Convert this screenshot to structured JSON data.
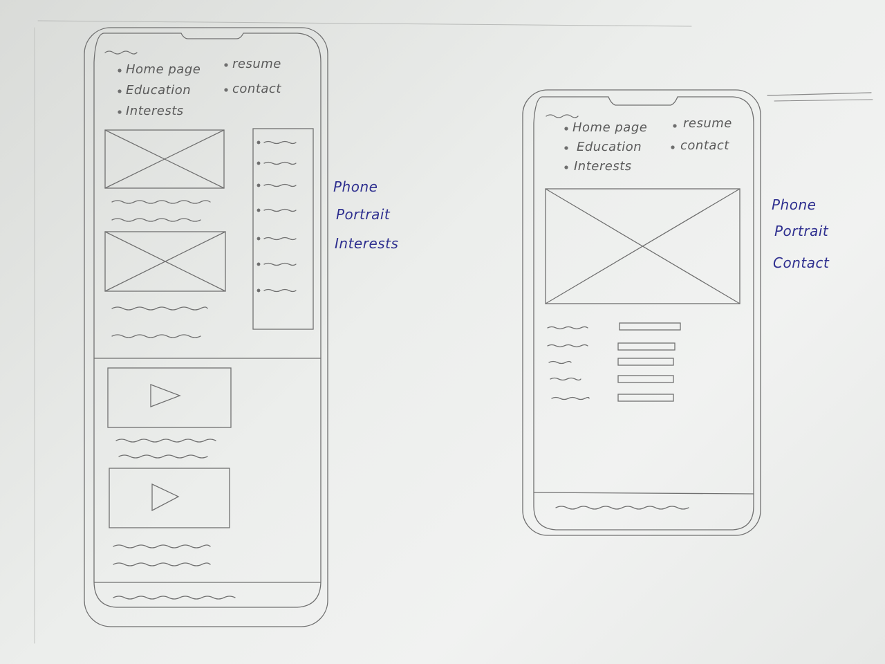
{
  "phone_interests": {
    "nav": {
      "left": [
        "Home page",
        "Education",
        "Interests"
      ],
      "right": [
        "resume",
        "contact"
      ]
    },
    "annotation": [
      "Phone",
      "Portrait",
      "Interests"
    ]
  },
  "phone_contact": {
    "nav": {
      "left": [
        "Home page",
        "Education",
        "Interests"
      ],
      "right": [
        "resume",
        "contact"
      ]
    },
    "annotation": [
      "Phone",
      "Portrait",
      "Contact"
    ]
  },
  "colors": {
    "pencil": "#6d6d6d",
    "ink": "#2e2f8f",
    "paper": "#eceeec"
  }
}
